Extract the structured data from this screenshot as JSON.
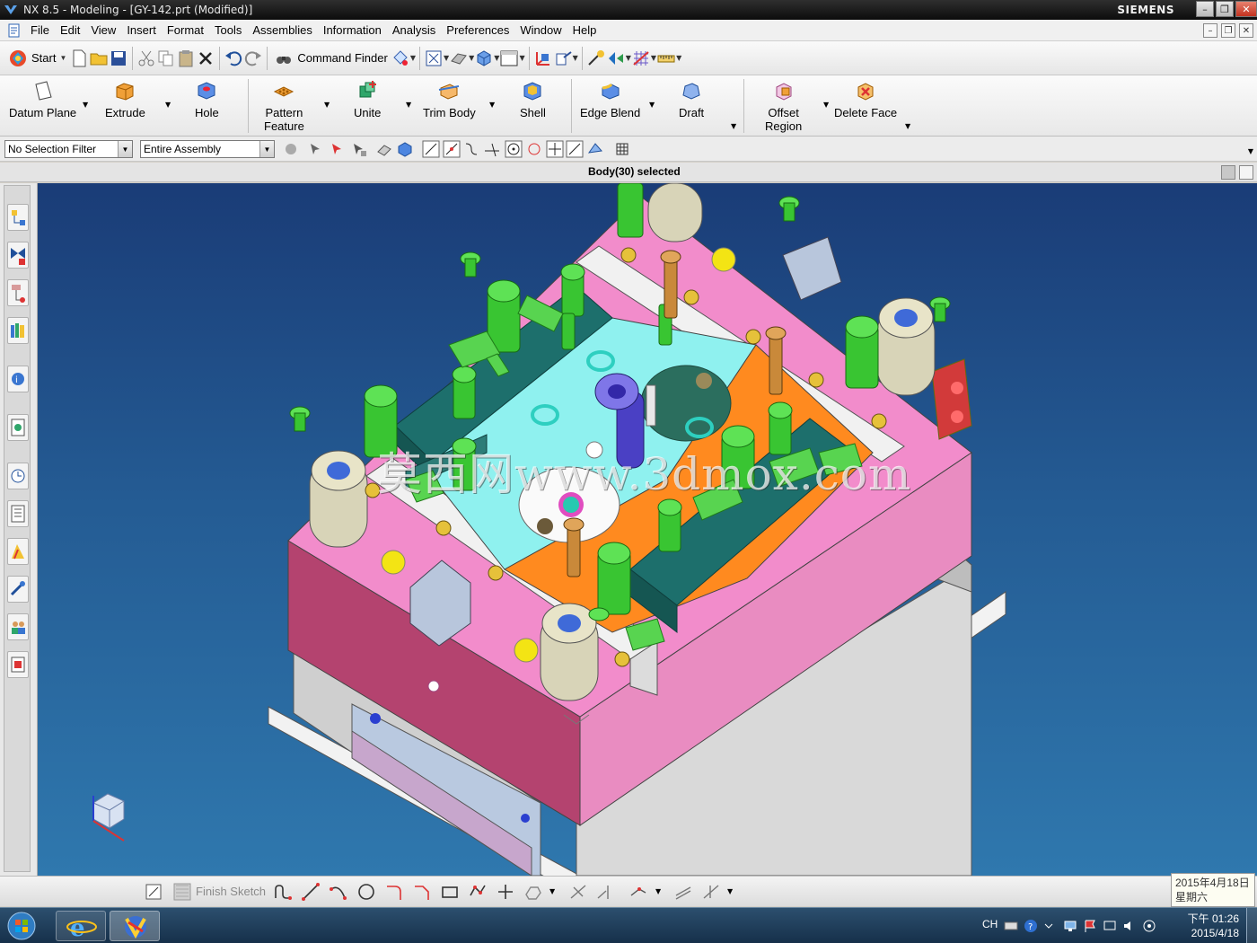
{
  "window": {
    "title": "NX 8.5 - Modeling - [GY-142.prt (Modified)]",
    "brand": "SIEMENS"
  },
  "menu": [
    "File",
    "Edit",
    "View",
    "Insert",
    "Format",
    "Tools",
    "Assemblies",
    "Information",
    "Analysis",
    "Preferences",
    "Window",
    "Help"
  ],
  "std_toolbar": {
    "start_label": "Start",
    "command_finder_label": "Command Finder"
  },
  "ribbon": [
    {
      "label": "Datum Plane",
      "icon": "datum-plane-icon"
    },
    {
      "label": "Extrude",
      "icon": "extrude-icon"
    },
    {
      "label": "Hole",
      "icon": "hole-icon"
    },
    {
      "label": "Pattern\nFeature",
      "icon": "pattern-feature-icon"
    },
    {
      "label": "Unite",
      "icon": "unite-icon"
    },
    {
      "label": "Trim Body",
      "icon": "trim-body-icon"
    },
    {
      "label": "Shell",
      "icon": "shell-icon"
    },
    {
      "label": "Edge Blend",
      "icon": "edge-blend-icon"
    },
    {
      "label": "Draft",
      "icon": "draft-icon"
    },
    {
      "label": "Offset\nRegion",
      "icon": "offset-region-icon"
    },
    {
      "label": "Delete Face",
      "icon": "delete-face-icon"
    }
  ],
  "selection": {
    "filter_value": "No Selection Filter",
    "scope_value": "Entire Assembly"
  },
  "status": {
    "text": "Body(30) selected"
  },
  "viewport": {
    "watermark": "莫西网www.3dmox.com",
    "colors": {
      "background_top": "#1a3c77",
      "background_bottom": "#2f78ae",
      "plate_pink": "#f08ac7",
      "plate_side": "#b3406e",
      "core_cyan": "#8ef3f0",
      "core_orange": "#ff8a1e",
      "slider_teal": "#1d6f6c",
      "bolt_green": "#38c832",
      "bushing": "#d8d4b8",
      "base_gray": "#e2e2e2"
    }
  },
  "sketch_toolbar": {
    "finish_label": "Finish Sketch"
  },
  "taskbar": {
    "language": "CH",
    "time": "下午 01:26",
    "date": "2015/4/18"
  },
  "date_tooltip": {
    "line1": "2015年4月18日",
    "line2": "星期六"
  }
}
